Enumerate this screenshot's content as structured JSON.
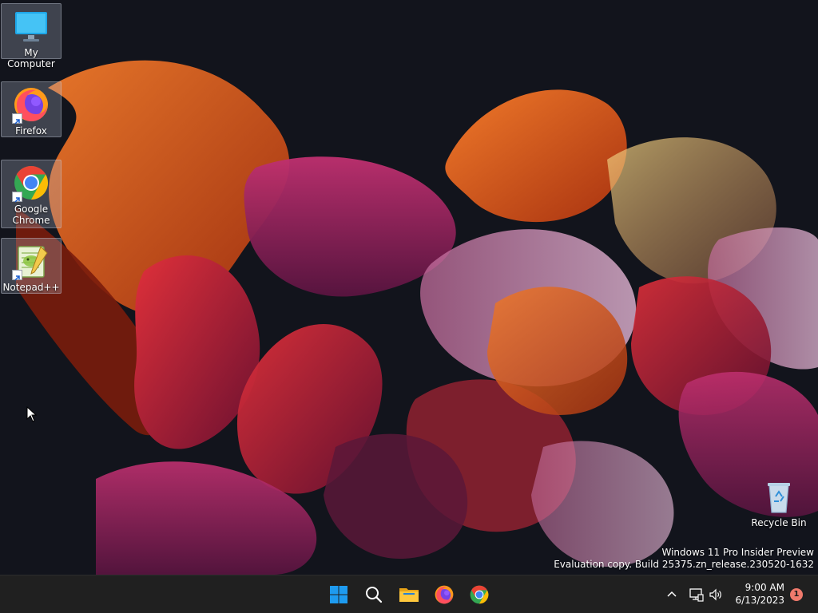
{
  "desktop": {
    "icons": [
      {
        "label": "My Computer",
        "icon": "monitor-icon"
      },
      {
        "label": "Firefox",
        "icon": "firefox-icon",
        "shortcut": true
      },
      {
        "label": "Google Chrome",
        "icon": "chrome-icon",
        "shortcut": true
      },
      {
        "label": "Notepad++",
        "icon": "notepad-plus-plus-icon",
        "shortcut": true
      },
      {
        "label": "Recycle Bin",
        "icon": "recycle-bin-icon"
      }
    ],
    "watermark": {
      "line1": "Windows 11 Pro Insider Preview",
      "line2": "Evaluation copy. Build 25375.zn_release.230520-1632"
    }
  },
  "taskbar": {
    "apps": [
      {
        "name": "Start",
        "icon": "windows-start-icon"
      },
      {
        "name": "Search",
        "icon": "search-icon"
      },
      {
        "name": "File Explorer",
        "icon": "folder-icon"
      },
      {
        "name": "Firefox",
        "icon": "firefox-icon"
      },
      {
        "name": "Google Chrome",
        "icon": "chrome-icon"
      }
    ],
    "tray": {
      "icons": [
        "chevron-up-icon",
        "network-icon",
        "speaker-icon"
      ],
      "time": "9:00 AM",
      "date": "6/13/2023",
      "notification_count": "1"
    }
  },
  "colors": {
    "taskbar_bg": "#202020",
    "desktop_bg": "#12141c",
    "start_blue": "#1e9bf0",
    "notification_badge": "#f07a6c"
  }
}
